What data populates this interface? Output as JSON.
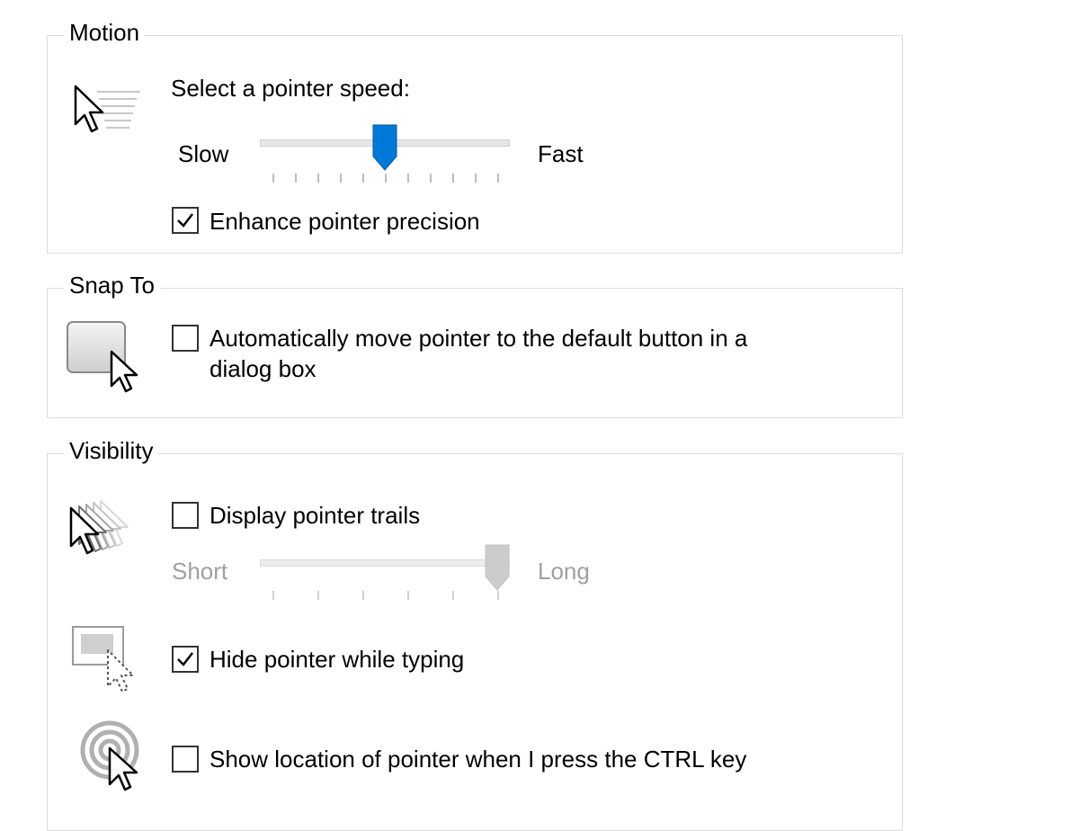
{
  "motion": {
    "legend": "Motion",
    "speed_label": "Select a pointer speed:",
    "slow_label": "Slow",
    "fast_label": "Fast",
    "speed_value": 0.5,
    "enhance_label": "Enhance pointer precision",
    "enhance_checked": true,
    "icon": "pointer-speed-icon"
  },
  "snap_to": {
    "legend": "Snap To",
    "auto_move_label_line1": "Automatically move pointer to the default button in a",
    "auto_move_label_line2": "dialog box",
    "auto_move_checked": false,
    "icon": "snap-to-button-icon"
  },
  "visibility": {
    "legend": "Visibility",
    "trails_label": "Display pointer trails",
    "trails_checked": false,
    "short_label": "Short",
    "long_label": "Long",
    "trails_value": 1.0,
    "hide_label": "Hide pointer while typing",
    "hide_checked": true,
    "show_location_label": "Show location of pointer when I press the CTRL key",
    "show_location_checked": false,
    "icons": [
      "pointer-trails-icon",
      "hide-pointer-icon",
      "pointer-location-icon"
    ]
  },
  "colors": {
    "accent": "#0078d7",
    "disabled": "#a0a0a0",
    "group_border": "#dcdcdc"
  }
}
